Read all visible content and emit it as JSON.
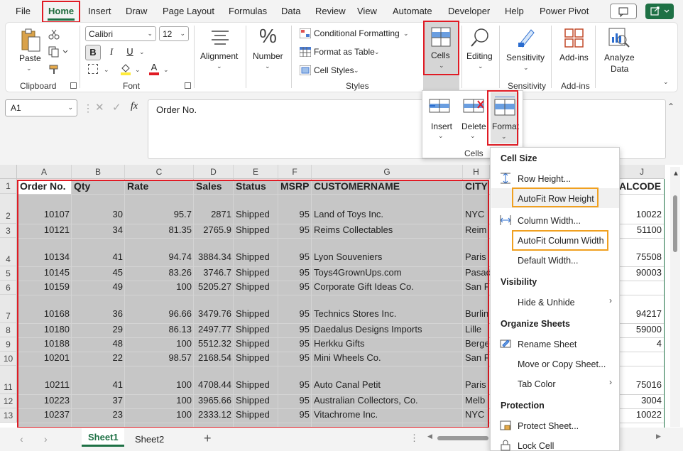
{
  "menu": {
    "tabs": [
      "File",
      "Home",
      "Insert",
      "Draw",
      "Page Layout",
      "Formulas",
      "Data",
      "Review",
      "View",
      "Automate",
      "Developer",
      "Help",
      "Power Pivot"
    ]
  },
  "ribbon": {
    "clipboard": {
      "paste": "Paste",
      "label": "Clipboard"
    },
    "font": {
      "name": "Calibri",
      "size": "12",
      "bold": "B",
      "italic": "I",
      "underline": "U",
      "fill_letter": "A",
      "color_letter": "A",
      "label": "Font"
    },
    "alignment": {
      "label": "Alignment"
    },
    "number": {
      "label": "Number",
      "icon": "%"
    },
    "styles": {
      "conditional": "Conditional Formatting",
      "format_table": "Format as Table",
      "cell_styles": "Cell Styles",
      "label": "Styles"
    },
    "cells": {
      "label": "Cells"
    },
    "editing": {
      "label": "Editing"
    },
    "sensitivity": {
      "label": "Sensitivity",
      "group": "Sensitivity"
    },
    "addins": {
      "label": "Add-ins",
      "group": "Add-ins"
    },
    "analyze": {
      "label1": "Analyze",
      "label2": "Data"
    }
  },
  "cells_dropdown": {
    "insert": "Insert",
    "delete": "Delete",
    "format": "Format",
    "label": "Cells"
  },
  "formula_bar": {
    "name_box": "A1",
    "fx": "fx",
    "value": "Order No."
  },
  "columns": [
    "A",
    "B",
    "C",
    "D",
    "E",
    "F",
    "G",
    "H",
    "J"
  ],
  "headers": {
    "A": "Order No.",
    "B": "Qty",
    "C": "Rate",
    "D": "Sales",
    "E": "Status",
    "F": "MSRP",
    "G": "CUSTOMERNAME",
    "H": "CITY",
    "J": "ALCODE"
  },
  "rows": [
    {
      "n": "2",
      "a": "10107",
      "b": "30",
      "c": "95.7",
      "d": "2871",
      "e": "Shipped",
      "f": "95",
      "g": "Land of Toys Inc.",
      "h": "NYC",
      "j": "10022"
    },
    {
      "n": "3",
      "a": "10121",
      "b": "34",
      "c": "81.35",
      "d": "2765.9",
      "e": "Shipped",
      "f": "95",
      "g": "Reims Collectables",
      "h": "Reim",
      "j": "51100"
    },
    {
      "n": "4",
      "a": "10134",
      "b": "41",
      "c": "94.74",
      "d": "3884.34",
      "e": "Shipped",
      "f": "95",
      "g": "Lyon Souveniers",
      "h": "Paris",
      "j": "75508"
    },
    {
      "n": "5",
      "a": "10145",
      "b": "45",
      "c": "83.26",
      "d": "3746.7",
      "e": "Shipped",
      "f": "95",
      "g": "Toys4GrownUps.com",
      "h": "Pasad",
      "j": "90003"
    },
    {
      "n": "6",
      "a": "10159",
      "b": "49",
      "c": "100",
      "d": "5205.27",
      "e": "Shipped",
      "f": "95",
      "g": "Corporate Gift Ideas Co.",
      "h": "San F",
      "j": ""
    },
    {
      "n": "7",
      "a": "10168",
      "b": "36",
      "c": "96.66",
      "d": "3479.76",
      "e": "Shipped",
      "f": "95",
      "g": "Technics Stores Inc.",
      "h": "Burlin",
      "j": "94217"
    },
    {
      "n": "8",
      "a": "10180",
      "b": "29",
      "c": "86.13",
      "d": "2497.77",
      "e": "Shipped",
      "f": "95",
      "g": "Daedalus Designs Imports",
      "h": "Lille",
      "j": "59000"
    },
    {
      "n": "9",
      "a": "10188",
      "b": "48",
      "c": "100",
      "d": "5512.32",
      "e": "Shipped",
      "f": "95",
      "g": "Herkku Gifts",
      "h": "Berge",
      "j": "4"
    },
    {
      "n": "10",
      "a": "10201",
      "b": "22",
      "c": "98.57",
      "d": "2168.54",
      "e": "Shipped",
      "f": "95",
      "g": "Mini Wheels Co.",
      "h": "San F",
      "j": ""
    },
    {
      "n": "11",
      "a": "10211",
      "b": "41",
      "c": "100",
      "d": "4708.44",
      "e": "Shipped",
      "f": "95",
      "g": "Auto Canal Petit",
      "h": "Paris",
      "j": "75016"
    },
    {
      "n": "12",
      "a": "10223",
      "b": "37",
      "c": "100",
      "d": "3965.66",
      "e": "Shipped",
      "f": "95",
      "g": "Australian Collectors, Co.",
      "h": "Melb",
      "j": "3004"
    },
    {
      "n": "13",
      "a": "10237",
      "b": "23",
      "c": "100",
      "d": "2333.12",
      "e": "Shipped",
      "f": "95",
      "g": "Vitachrome Inc.",
      "h": "NYC",
      "j": "10022"
    }
  ],
  "format_menu": {
    "cell_size": "Cell Size",
    "row_height": "Row Height...",
    "autofit_row": "AutoFit Row Height",
    "column_width": "Column Width...",
    "autofit_column": "AutoFit Column Width",
    "default_width": "Default Width...",
    "visibility": "Visibility",
    "hide_unhide": "Hide & Unhide",
    "organize": "Organize Sheets",
    "rename": "Rename Sheet",
    "move_copy": "Move or Copy Sheet...",
    "tab_color": "Tab Color",
    "protection": "Protection",
    "protect_sheet": "Protect Sheet...",
    "lock_cell": "Lock Cell"
  },
  "sheets": [
    "Sheet1",
    "Sheet2"
  ],
  "colors": {
    "excel_green": "#1e7145",
    "highlight_red": "#e01b24",
    "highlight_orange": "#f0a020",
    "selection_gray": "#c6c6c6"
  }
}
